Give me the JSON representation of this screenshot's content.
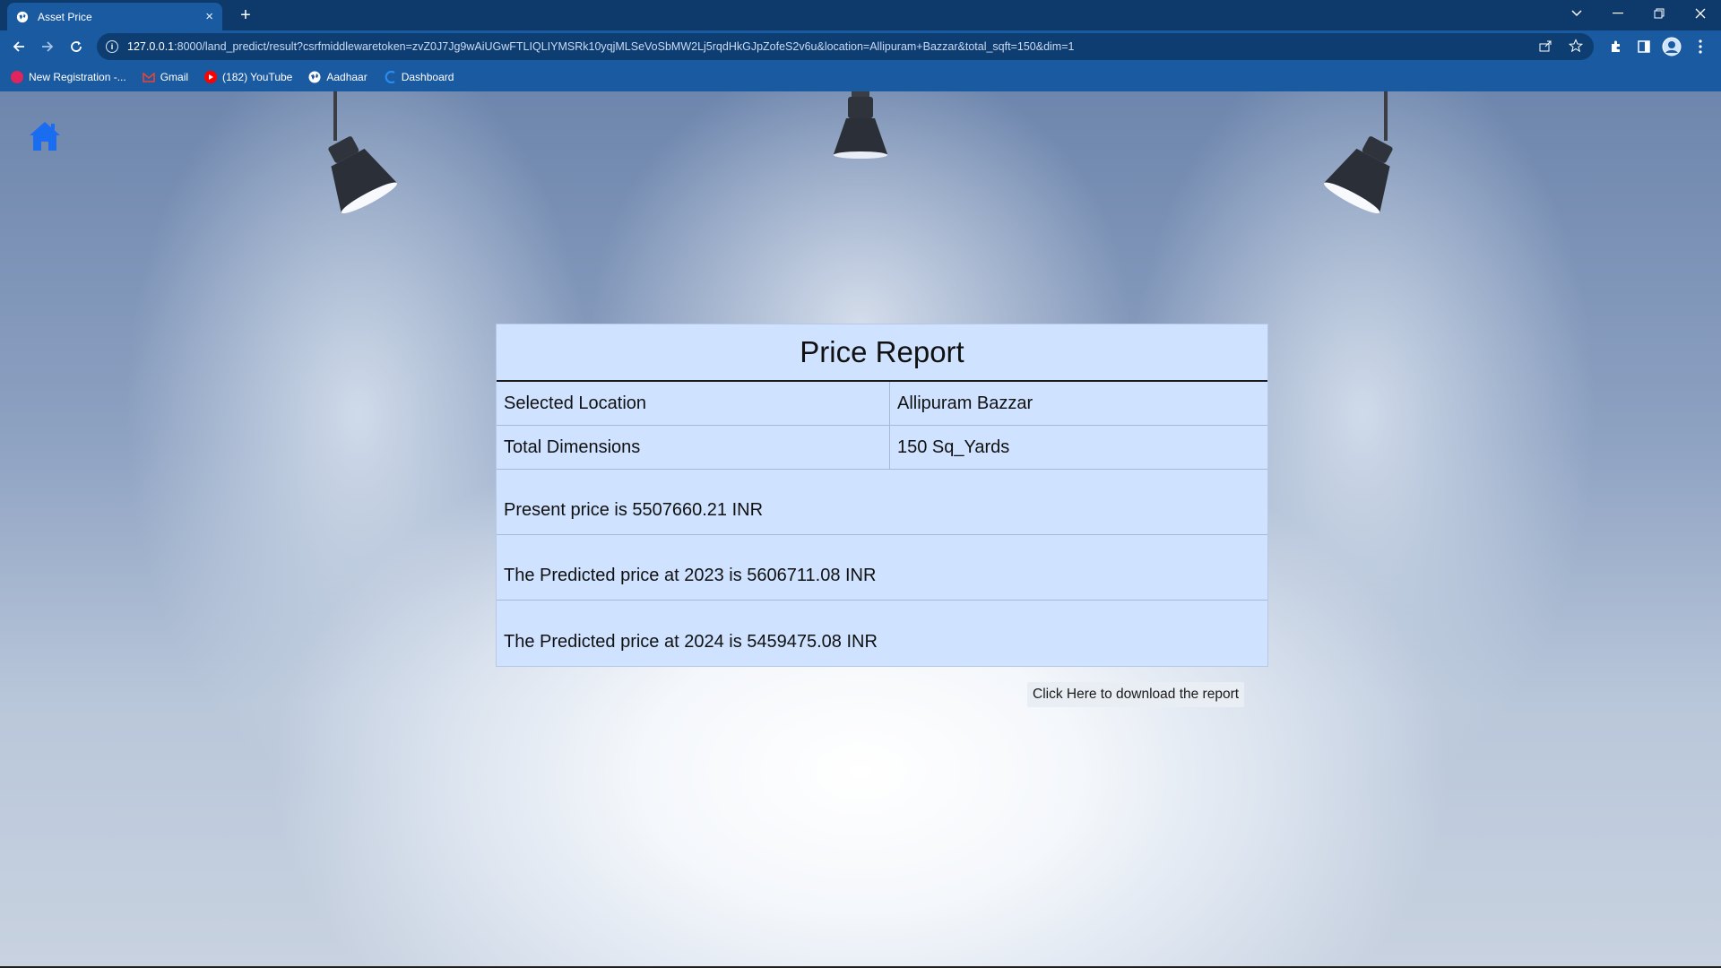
{
  "browser": {
    "tab_title": "Asset Price",
    "tab_close": "×",
    "new_tab": "+",
    "url_host": "127.0.0.1",
    "url_rest": ":8000/land_predict/result?csrfmiddlewaretoken=zvZ0J7Jg9wAiUGwFTLIQLIYMSRk10yqjMLSeVoSbMW2Lj5rqdHkGJpZofeS2v6u&location=Allipuram+Bazzar&total_sqft=150&dim=1",
    "bookmarks": [
      {
        "label": "New Registration -...",
        "color": "#e0245e"
      },
      {
        "label": "Gmail",
        "color": "#ea4335"
      },
      {
        "label": "(182) YouTube",
        "color": "#ff0000"
      },
      {
        "label": "Aadhaar",
        "color": "#ffffff"
      },
      {
        "label": "Dashboard",
        "color": "#2a8bf2"
      }
    ]
  },
  "report": {
    "title": "Price Report",
    "location_label": "Selected Location",
    "location_value": "Allipuram Bazzar",
    "dimensions_label": "Total Dimensions",
    "dimensions_value": "150 Sq_Yards",
    "present_price": "Present price is 5507660.21 INR",
    "predicted_2023": "The Predicted price at 2023 is 5606711.08 INR",
    "predicted_2024": "The Predicted price at 2024 is 5459475.08 INR"
  },
  "download_link": "Click Here to download the report",
  "colors": {
    "chrome_dark": "#0d3a6b",
    "chrome": "#1a5aa0",
    "report_bg": "#cfe2ff",
    "home_icon": "#1a6cf0"
  }
}
